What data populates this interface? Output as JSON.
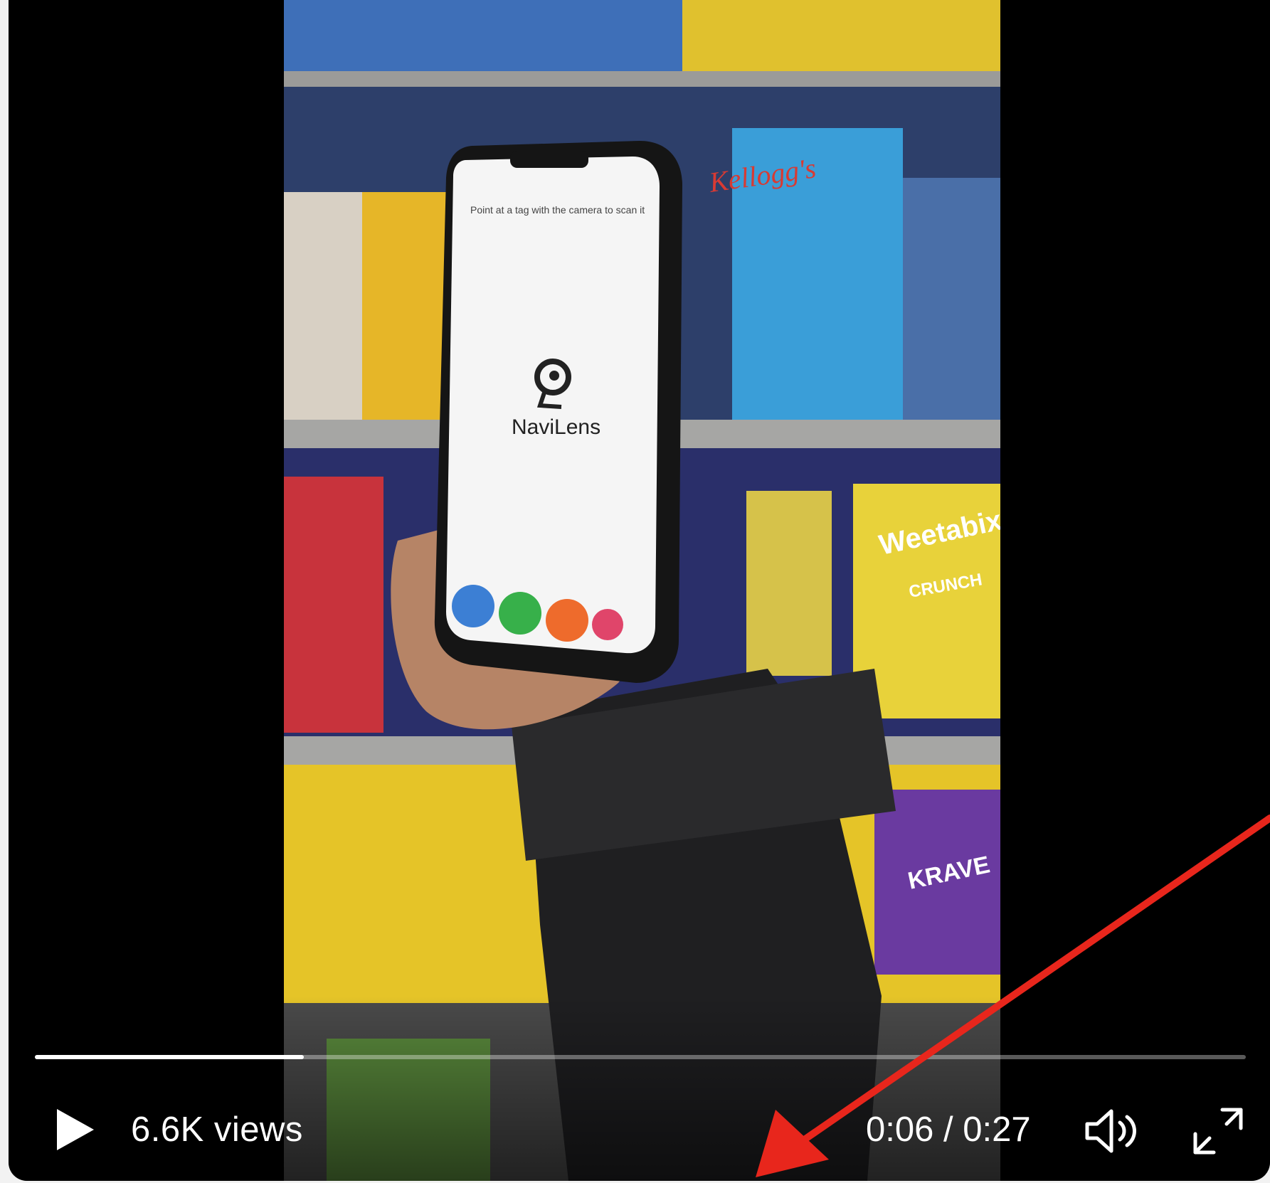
{
  "player": {
    "views_label": "6.6K views",
    "current_time": "0:06",
    "separator": "/",
    "duration": "0:27",
    "progress_fraction": 0.222,
    "icons": {
      "play": "play-icon",
      "volume": "volume-icon",
      "fullscreen": "fullscreen-expand-icon"
    }
  },
  "video_frame": {
    "phone_screen": {
      "instruction": "Point at a tag with the camera to scan it",
      "app_name": "NaviLens"
    },
    "shelf_labels": [
      "Weetabix",
      "CRUNCH",
      "KRAVE",
      "Kellogg's"
    ]
  },
  "annotation": {
    "arrow_color": "#e8261c"
  },
  "colors": {
    "player_bg": "#000000",
    "control_text": "#ffffff"
  }
}
